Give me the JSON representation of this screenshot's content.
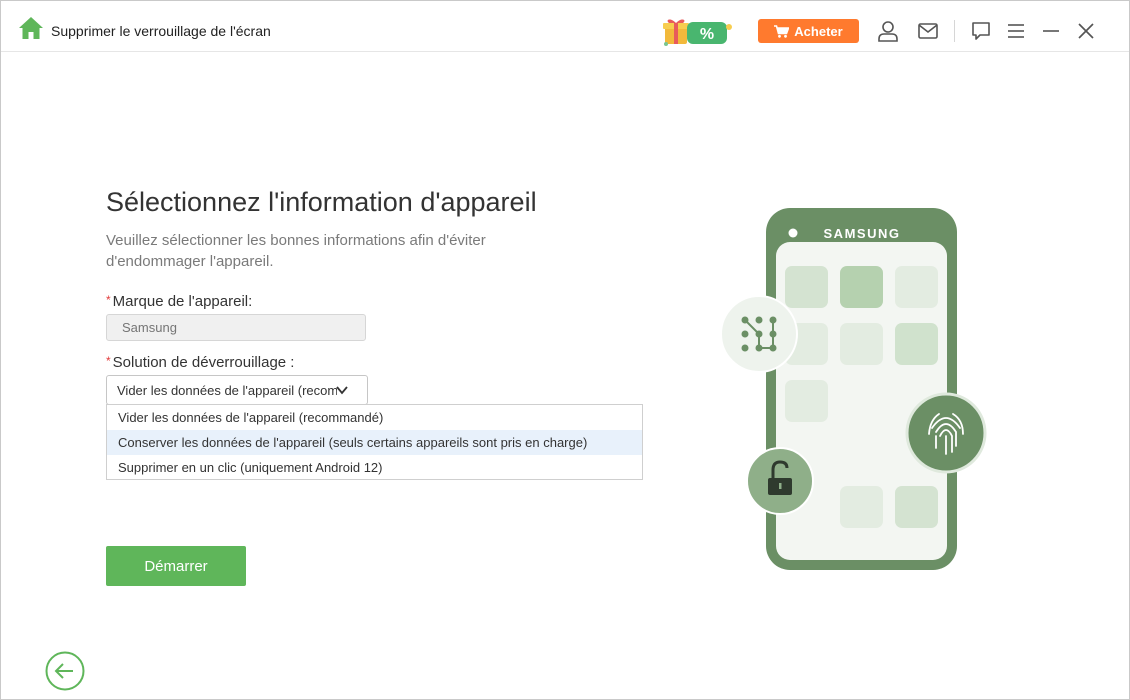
{
  "window": {
    "title": "Supprimer le verrouillage de l'écran",
    "buy_label": "Acheter",
    "promo_badge": "%"
  },
  "main": {
    "heading": "Sélectionnez l'information d'appareil",
    "subtitle": "Veuillez sélectionner les bonnes informations afin d'éviter d'endommager l'appareil.",
    "brand_label": "Marque de l'appareil:",
    "brand_placeholder": "Samsung",
    "solution_label": "Solution de déverrouillage :",
    "solution_selected": "Vider les données de l'appareil (recommandé)",
    "options": [
      "Vider les données de l'appareil (recommandé)",
      "Conserver les données de l'appareil (seuls certains appareils sont pris en charge)",
      "Supprimer en un clic (uniquement Android 12)"
    ],
    "start_label": "Démarrer"
  },
  "illustration": {
    "brand": "SAMSUNG"
  },
  "icons": {
    "home": "home-icon",
    "cart": "cart-icon",
    "account": "user-icon",
    "mail": "mail-icon",
    "feedback": "chat-icon",
    "menu": "menu-icon",
    "minimize": "minimize-icon",
    "close": "close-icon",
    "back": "back-arrow-icon"
  },
  "colors": {
    "accent_green": "#5fb65a",
    "buy_orange": "#ff7a2e",
    "phone_green": "#6b8f65",
    "option_hover": "#e8f1fb"
  }
}
